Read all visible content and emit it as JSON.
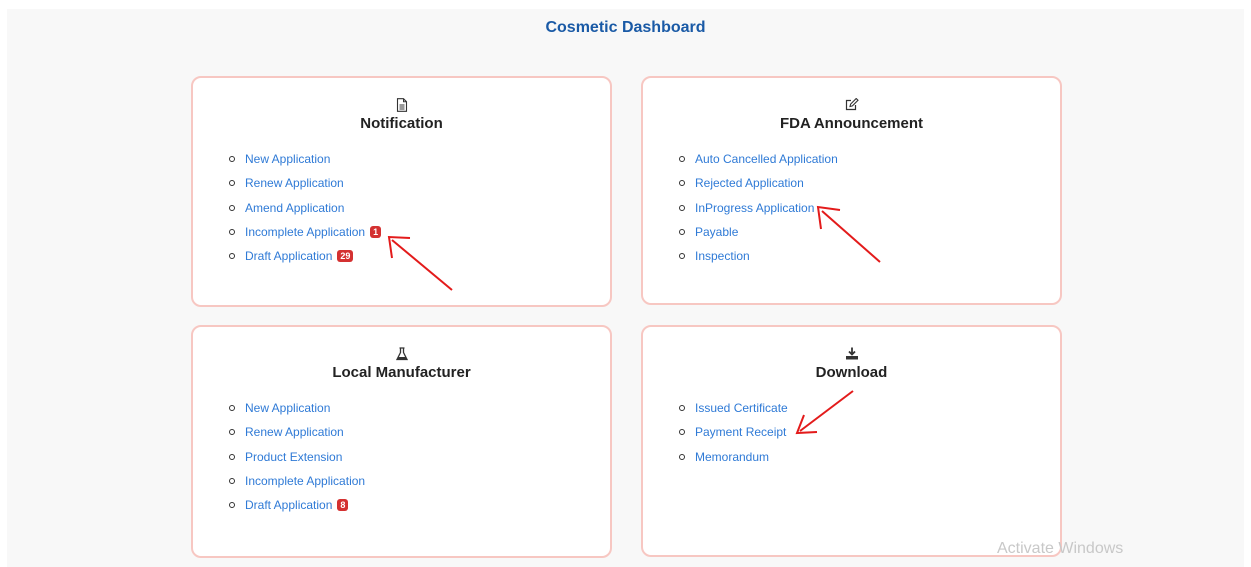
{
  "page": {
    "title": "Cosmetic Dashboard"
  },
  "cards": [
    {
      "icon": "document-icon",
      "title": "Notification",
      "items": [
        {
          "label": "New Application",
          "badge": ""
        },
        {
          "label": "Renew Application",
          "badge": ""
        },
        {
          "label": "Amend Application",
          "badge": ""
        },
        {
          "label": "Incomplete Application",
          "badge": "1"
        },
        {
          "label": "Draft Application",
          "badge": "29"
        }
      ]
    },
    {
      "icon": "edit-icon",
      "title": "FDA Announcement",
      "items": [
        {
          "label": "Auto Cancelled Application",
          "badge": ""
        },
        {
          "label": "Rejected Application",
          "badge": ""
        },
        {
          "label": "InProgress Application",
          "badge": ""
        },
        {
          "label": "Payable",
          "badge": ""
        },
        {
          "label": "Inspection",
          "badge": ""
        }
      ]
    },
    {
      "icon": "flask-icon",
      "title": "Local Manufacturer",
      "items": [
        {
          "label": "New Application",
          "badge": ""
        },
        {
          "label": "Renew Application",
          "badge": ""
        },
        {
          "label": "Product Extension",
          "badge": ""
        },
        {
          "label": "Incomplete Application",
          "badge": ""
        },
        {
          "label": "Draft Application",
          "badge": "8"
        }
      ]
    },
    {
      "icon": "download-icon",
      "title": "Download",
      "items": [
        {
          "label": "Issued Certificate",
          "badge": ""
        },
        {
          "label": "Payment Receipt",
          "badge": ""
        },
        {
          "label": "Memorandum",
          "badge": ""
        }
      ]
    }
  ],
  "watermark": {
    "text": "Activate Windows"
  },
  "colors": {
    "title": "#1a5aa6",
    "link": "#2f7ad6",
    "badge": "#d43131",
    "card_border": "#f7c7c2",
    "annotation_arrow": "#e31b1b"
  }
}
